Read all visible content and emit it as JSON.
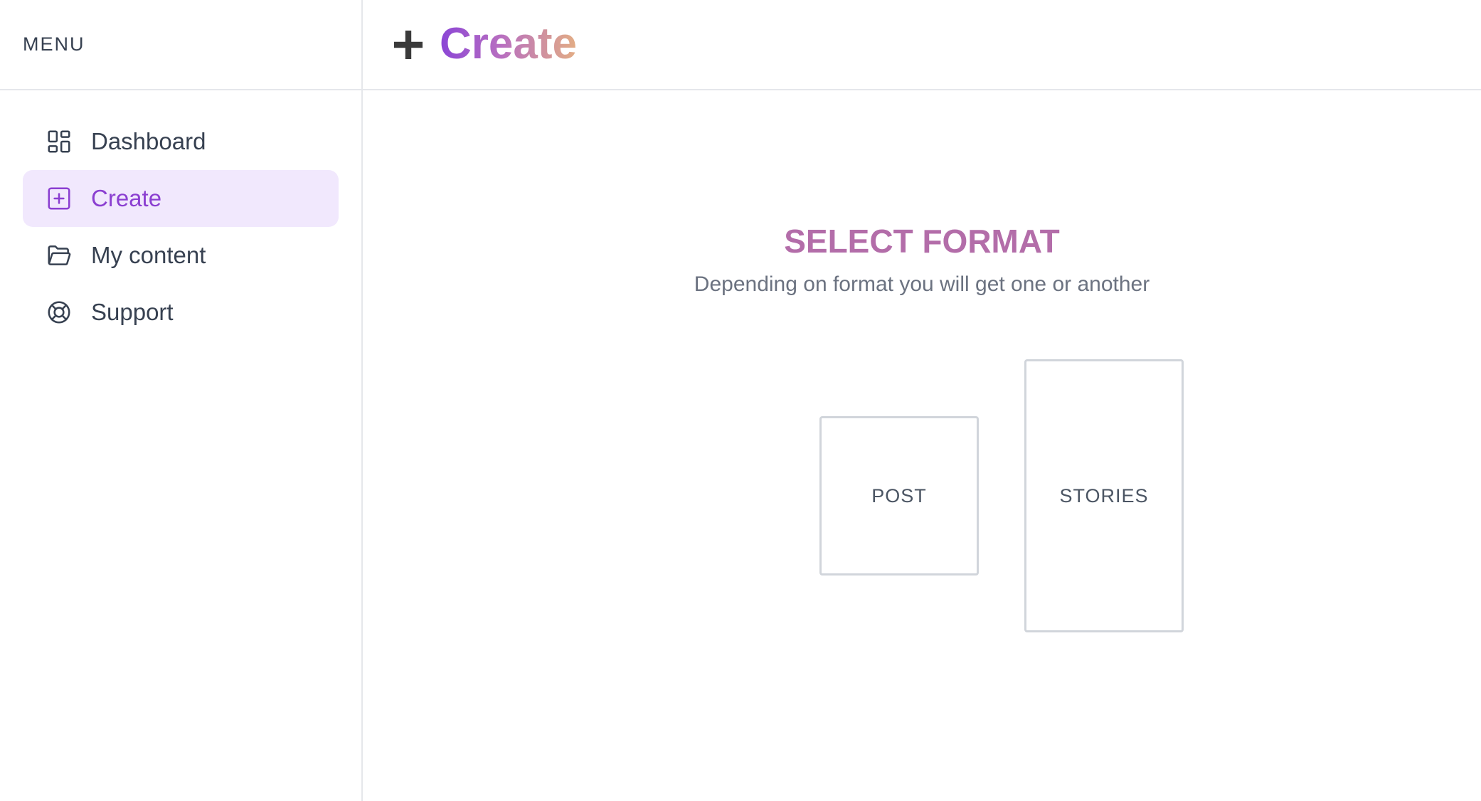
{
  "sidebar": {
    "title": "MENU",
    "items": [
      {
        "label": "Dashboard",
        "icon": "dashboard-icon",
        "active": false
      },
      {
        "label": "Create",
        "icon": "plus-square-icon",
        "active": true
      },
      {
        "label": "My content",
        "icon": "folder-open-icon",
        "active": false
      },
      {
        "label": "Support",
        "icon": "lifebuoy-icon",
        "active": false
      }
    ]
  },
  "header": {
    "title": "Create",
    "icon": "plus-icon"
  },
  "main": {
    "section_title": "SELECT FORMAT",
    "section_subtitle": "Depending on format you will get one or another",
    "formats": [
      {
        "label": "POST"
      },
      {
        "label": "STORIES"
      }
    ]
  },
  "colors": {
    "accent": "#8b3fd1",
    "active_bg": "#f1e8fd",
    "title_gradient_start": "#8b45d6",
    "title_gradient_end": "#e3ad84",
    "section_title": "#b36da9",
    "border": "#e5e7eb"
  }
}
